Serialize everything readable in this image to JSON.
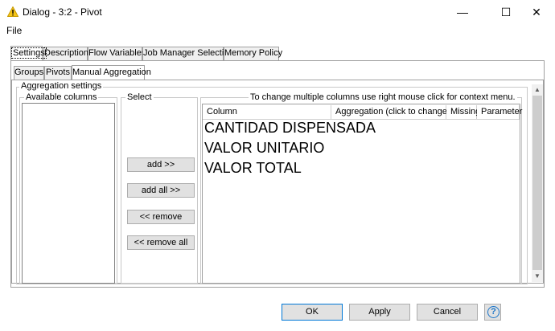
{
  "window": {
    "title": "Dialog - 3:2 - Pivot",
    "minimize": "—",
    "maximize": "☐",
    "close": "✕"
  },
  "menu": {
    "file": "File"
  },
  "outer_tabs": [
    "Settings",
    "Description",
    "Flow Variables",
    "Job Manager Selection",
    "Memory Policy"
  ],
  "inner_tabs": [
    "Groups",
    "Pivots",
    "Manual Aggregation"
  ],
  "aggregation": {
    "group_label": "Aggregation settings",
    "available_label": "Available columns",
    "select_label": "Select",
    "table_label": "To change multiple columns use right mouse click for context menu.",
    "buttons": {
      "add": "add >>",
      "add_all": "add all >>",
      "remove": "<< remove",
      "remove_all": "<< remove all"
    },
    "columns": [
      "Column",
      "Aggregation (click to change)",
      "Missing",
      "Parameter"
    ],
    "rows": [
      "CANTIDAD DISPENSADA",
      "VALOR UNITARIO",
      "VALOR TOTAL"
    ]
  },
  "footer": {
    "ok": "OK",
    "apply": "Apply",
    "cancel": "Cancel",
    "help": "?"
  },
  "colors": {
    "accent": "#0078d7",
    "help": "#1b75c9",
    "warning_icon": "#f5c518"
  }
}
